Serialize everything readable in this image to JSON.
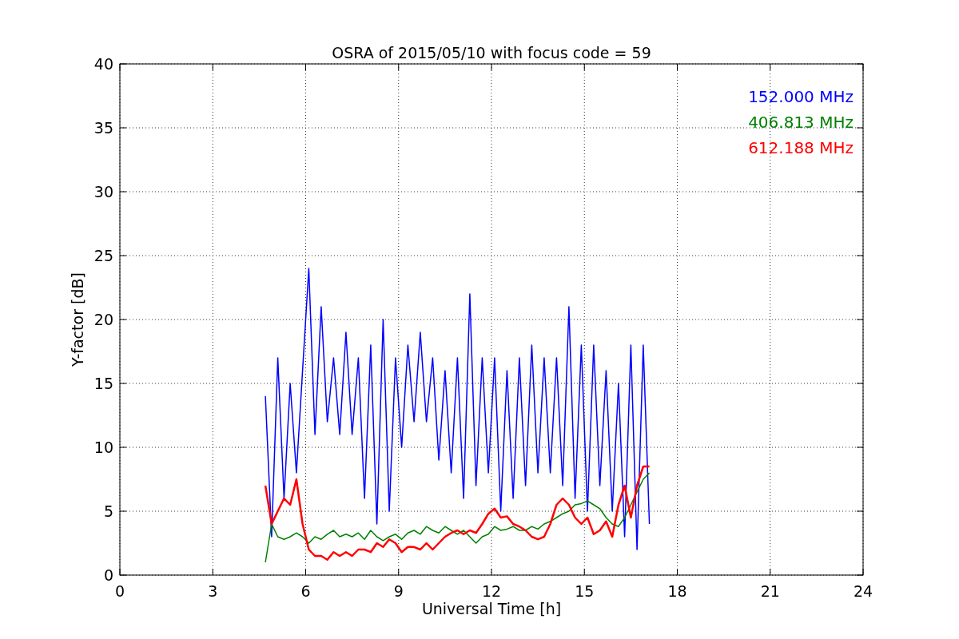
{
  "figure": {
    "chart_data": {
      "type": "line",
      "title": "OSRA of 2015/05/10 with focus code = 59",
      "xlabel": "Universal Time [h]",
      "ylabel": "Y-factor [dB]",
      "xlim": [
        0,
        24
      ],
      "ylim": [
        0,
        40
      ],
      "xticks": [
        0,
        3,
        6,
        9,
        12,
        15,
        18,
        21,
        24
      ],
      "yticks": [
        0,
        5,
        10,
        15,
        20,
        25,
        30,
        35,
        40
      ],
      "grid": true,
      "x": [
        4.7,
        4.9,
        5.1,
        5.3,
        5.5,
        5.7,
        5.9,
        6.1,
        6.3,
        6.5,
        6.7,
        6.9,
        7.1,
        7.3,
        7.5,
        7.7,
        7.9,
        8.1,
        8.3,
        8.5,
        8.7,
        8.9,
        9.1,
        9.3,
        9.5,
        9.7,
        9.9,
        10.1,
        10.3,
        10.5,
        10.7,
        10.9,
        11.1,
        11.3,
        11.5,
        11.7,
        11.9,
        12.1,
        12.3,
        12.5,
        12.7,
        12.9,
        13.1,
        13.3,
        13.5,
        13.7,
        13.9,
        14.1,
        14.3,
        14.5,
        14.7,
        14.9,
        15.1,
        15.3,
        15.5,
        15.7,
        15.9,
        16.1,
        16.3,
        16.5,
        16.7,
        16.9,
        17.1
      ],
      "series": [
        {
          "name": "152.000 MHz",
          "color": "#0000ff",
          "values": [
            14,
            3,
            17,
            6,
            15,
            8,
            16,
            24,
            11,
            21,
            12,
            17,
            11,
            19,
            11,
            17,
            6,
            18,
            4,
            20,
            5,
            17,
            10,
            18,
            12,
            19,
            12,
            17,
            9,
            16,
            8,
            17,
            6,
            22,
            7,
            17,
            8,
            17,
            5,
            16,
            6,
            17,
            7,
            18,
            8,
            17,
            8,
            17,
            7,
            21,
            6,
            18,
            5,
            18,
            7,
            16,
            5,
            15,
            3,
            18,
            2,
            18,
            4
          ]
        },
        {
          "name": "406.813 MHz",
          "color": "#008000",
          "values": [
            1,
            4,
            3,
            2.8,
            3,
            3.3,
            3,
            2.5,
            3,
            2.8,
            3.2,
            3.5,
            3,
            3.2,
            3,
            3.3,
            2.8,
            3.5,
            3,
            2.7,
            3,
            3.2,
            2.8,
            3.3,
            3.5,
            3.2,
            3.8,
            3.5,
            3.3,
            3.8,
            3.5,
            3.2,
            3.5,
            3,
            2.5,
            3,
            3.2,
            3.8,
            3.5,
            3.6,
            3.8,
            3.5,
            3.5,
            3.8,
            3.6,
            4,
            4.2,
            4.5,
            4.8,
            5,
            5.5,
            5.6,
            5.8,
            5.5,
            5.2,
            4.5,
            4,
            3.8,
            4.5,
            5.5,
            6.5,
            7.5,
            8
          ]
        },
        {
          "name": "612.188 MHz",
          "color": "#ff0000",
          "values": [
            7,
            4,
            5,
            6,
            5.5,
            7.5,
            4,
            2,
            1.5,
            1.5,
            1.2,
            1.8,
            1.5,
            1.8,
            1.5,
            2,
            2,
            1.8,
            2.5,
            2.2,
            2.8,
            2.5,
            1.8,
            2.2,
            2.2,
            2,
            2.5,
            2,
            2.5,
            3,
            3.3,
            3.5,
            3.2,
            3.5,
            3.3,
            4,
            4.8,
            5.2,
            4.5,
            4.6,
            4,
            3.8,
            3.5,
            3,
            2.8,
            3,
            4,
            5.5,
            6,
            5.5,
            4.5,
            4,
            4.5,
            3.2,
            3.5,
            4.2,
            3,
            5.5,
            7,
            4.5,
            7,
            8.5,
            8.5
          ]
        }
      ]
    }
  }
}
